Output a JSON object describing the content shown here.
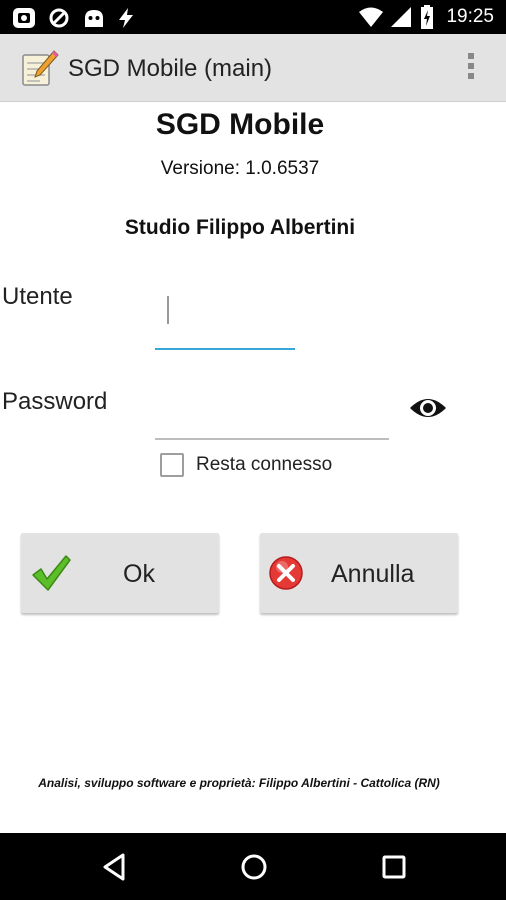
{
  "status_bar": {
    "time": "19:25",
    "icons": [
      "screenshot-icon",
      "data-saver-icon",
      "android-debug-icon",
      "flash-icon",
      "wifi-icon",
      "signal-icon",
      "battery-charging-icon"
    ]
  },
  "action_bar": {
    "app_icon": "notepad-pencil-icon",
    "title": "SGD Mobile (main)",
    "overflow_icon": "more-vert-icon"
  },
  "login": {
    "heading": "SGD Mobile",
    "version": "Versione: 1.0.6537",
    "studio": "Studio Filippo Albertini",
    "user_label": "Utente",
    "user_value": "",
    "password_label": "Password",
    "password_value": "",
    "show_password_icon": "eye-icon",
    "remember_label": "Resta connesso",
    "remember_checked": false,
    "ok_label": "Ok",
    "cancel_label": "Annulla"
  },
  "footer": {
    "text": "Analisi, sviluppo software e proprietà: Filippo Albertini - Cattolica (RN)"
  },
  "nav_bar": {
    "icons": [
      "back-icon",
      "home-icon",
      "recents-icon"
    ]
  },
  "colors": {
    "status_bar": "#000000",
    "action_bar": "#e3e3e3",
    "input_focus": "#36a8d8",
    "button": "#e2e2e2",
    "ok_check": "#5cbf2a",
    "cancel_red": "#e53935"
  }
}
